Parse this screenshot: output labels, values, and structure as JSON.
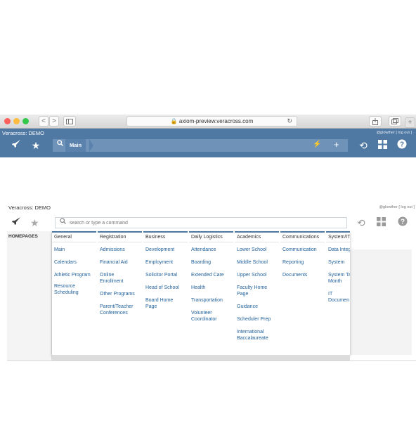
{
  "browser": {
    "url": "axiom-preview.veracross.com",
    "nav_back": "<",
    "nav_forward": ">"
  },
  "app": {
    "title": "Veracross: DEMO",
    "user": "@glowther",
    "logout": "[ log out ]",
    "breadcrumb": "Main",
    "search_placeholder": "search or type a command"
  },
  "menu": {
    "homepages_label": "HOMEPAGES",
    "columns": [
      {
        "heading": "General",
        "items": [
          "Main",
          "Calendars",
          "Athletic Program",
          "Resource Scheduling"
        ]
      },
      {
        "heading": "Registration",
        "items": [
          "Admissions",
          "Financial Aid",
          "Online Enrollment",
          "Other Programs",
          "Parent/Teacher Conferences"
        ]
      },
      {
        "heading": "Business",
        "items": [
          "Development",
          "Employment",
          "Solicitor Portal",
          "Head of School",
          "Board Home Page"
        ]
      },
      {
        "heading": "Daily Logistics",
        "items": [
          "Attendance",
          "Boarding",
          "Extended Care",
          "Health",
          "Transportation",
          "Volunteer Coordinator"
        ]
      },
      {
        "heading": "Academics",
        "items": [
          "Lower School",
          "Middle School",
          "Upper School",
          "Faculty Home Page",
          "Guidance",
          "Scheduler Prep",
          "International Baccalaureate"
        ]
      },
      {
        "heading": "Communications",
        "items": [
          "Communication",
          "Reporting",
          "Documents"
        ]
      },
      {
        "heading": "System/IT",
        "items": [
          "Data Integ",
          "System",
          "System Ta Month",
          "IT Documen"
        ]
      }
    ]
  },
  "colors": {
    "header_blue": "#4f78a3",
    "link_blue": "#1f5f99"
  }
}
